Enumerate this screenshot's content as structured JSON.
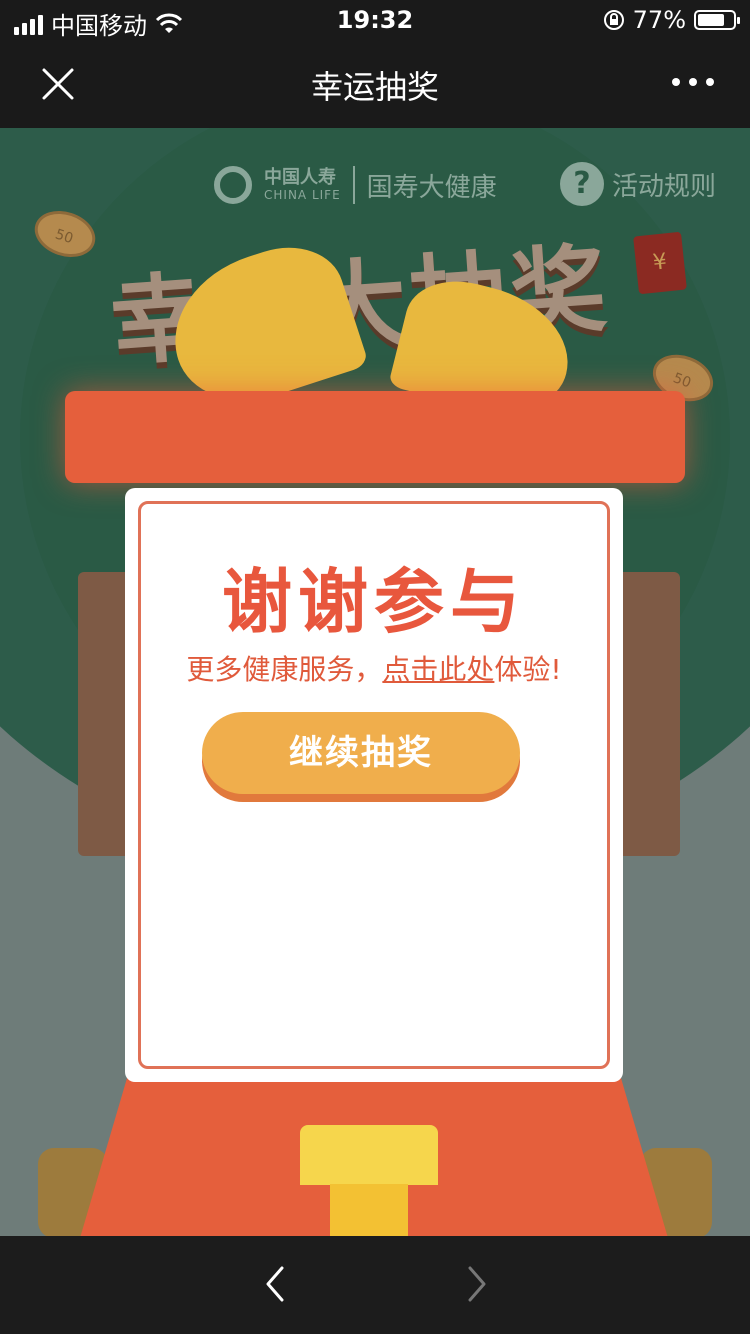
{
  "status": {
    "carrier": "中国移动",
    "time": "19:32",
    "battery_percent": "77%",
    "battery_level": 0.77
  },
  "nav": {
    "title": "幸运抽奖"
  },
  "brand": {
    "cn": "中国人寿",
    "en": "CHINA LIFE",
    "sub_brand": "国寿大健康"
  },
  "rules_label": "活动规则",
  "big_title": "幸运大抽奖",
  "decor": {
    "coin_label": "50",
    "envelope_symbol": "¥"
  },
  "card": {
    "title": "谢谢参与",
    "subtitle_prefix": "更多健康服务，",
    "subtitle_link": "点击此处",
    "subtitle_suffix": "体验!",
    "button": "继续抽奖"
  },
  "colors": {
    "accent_red": "#e8573d",
    "button_orange": "#f0ae4c",
    "bg_green": "#2a5a45"
  }
}
